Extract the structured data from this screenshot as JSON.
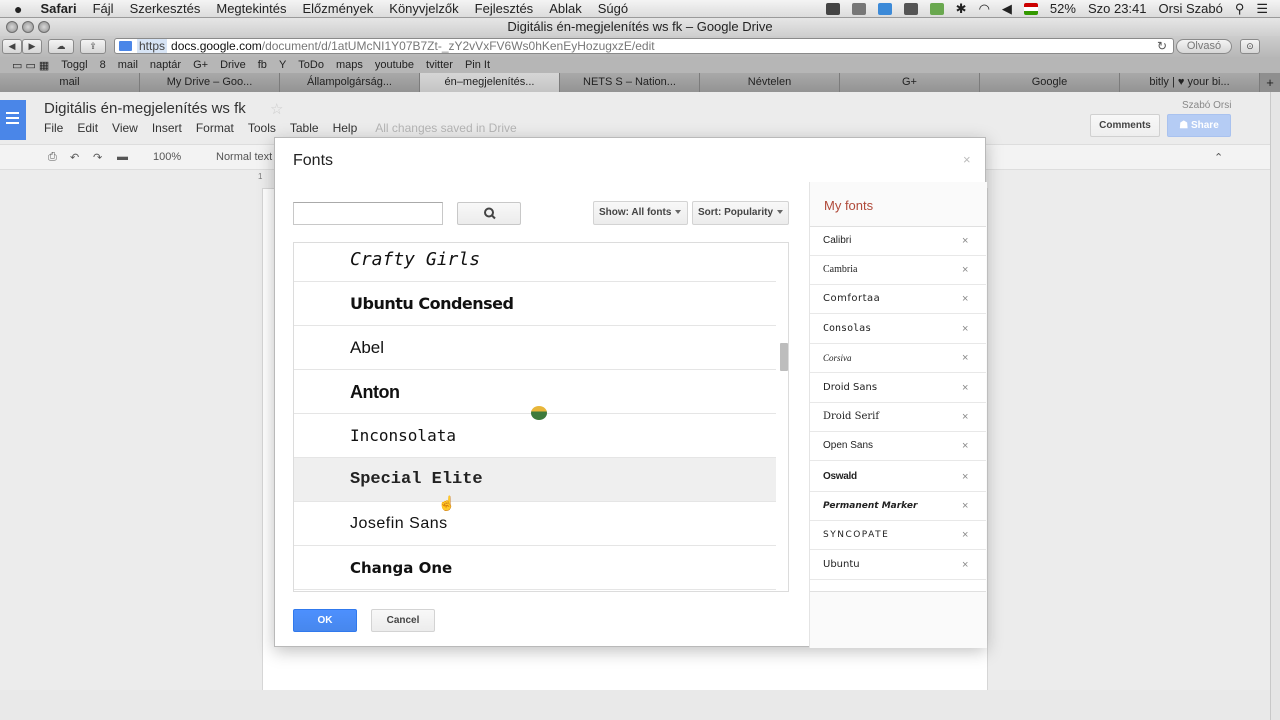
{
  "menubar": {
    "app": "Safari",
    "items": [
      "Fájl",
      "Szerkesztés",
      "Megtekintés",
      "Előzmények",
      "Könyvjelzők",
      "Fejlesztés",
      "Ablak",
      "Súgó"
    ],
    "battery": "52%",
    "clock": "Szo 23:41",
    "user": "Orsi Szabó"
  },
  "window": {
    "title": "Digitális én-megjelenítés ws fk – Google Drive"
  },
  "toolbar": {
    "url_scheme": "https",
    "url_host": "docs.google.com",
    "url_path": "/document/d/1atUMcNI1Y07B7Zt-_zY2vVxFV6Ws0hKenEyHozugxzE/edit",
    "reader_label": "Olvasó"
  },
  "bookmarks": [
    "Toggl",
    "8",
    "mail",
    "naptár",
    "G+",
    "Drive",
    "fb",
    "Y",
    "ToDo",
    "maps",
    "youtube",
    "tvitter",
    "Pin It"
  ],
  "tabs": [
    "mail",
    "My Drive – Goo...",
    "Állampolgárság...",
    "én–megjelenítés...",
    "NETS S – Nation...",
    "Névtelen",
    "G+",
    "Google",
    "bitly | ♥ your bi..."
  ],
  "docs": {
    "title": "Digitális én-megjelenítés ws fk",
    "menu": [
      "File",
      "Edit",
      "View",
      "Insert",
      "Format",
      "Tools",
      "Table",
      "Help"
    ],
    "status": "All changes saved in Drive",
    "user": "Szabó Orsi",
    "comments_label": "Comments",
    "share_label": "Share",
    "zoom": "100%",
    "style": "Normal text",
    "ruler_mark": "1"
  },
  "modal": {
    "title": "Fonts",
    "close": "×",
    "search_value": "",
    "show_label": "Show: All fonts",
    "sort_label": "Sort: Popularity",
    "fonts": [
      "Crafty Girls",
      "Ubuntu Condensed",
      "Abel",
      "Anton",
      "Inconsolata",
      "Special Elite",
      "Josefin Sans",
      "Changa One"
    ],
    "my_fonts_title": "My fonts",
    "my_fonts": [
      "Calibri",
      "Cambria",
      "Comfortaa",
      "Consolas",
      "Corsiva",
      "Droid Sans",
      "Droid Serif",
      "Open Sans",
      "Oswald",
      "Permanent Marker",
      "Syncopate",
      "Ubuntu"
    ],
    "remove_glyph": "×",
    "ok_label": "OK",
    "cancel_label": "Cancel"
  },
  "colors": {
    "docs_blue": "#4a86e8",
    "ok_blue": "#4d90fe",
    "my_fonts_title": "#b04a3a"
  }
}
